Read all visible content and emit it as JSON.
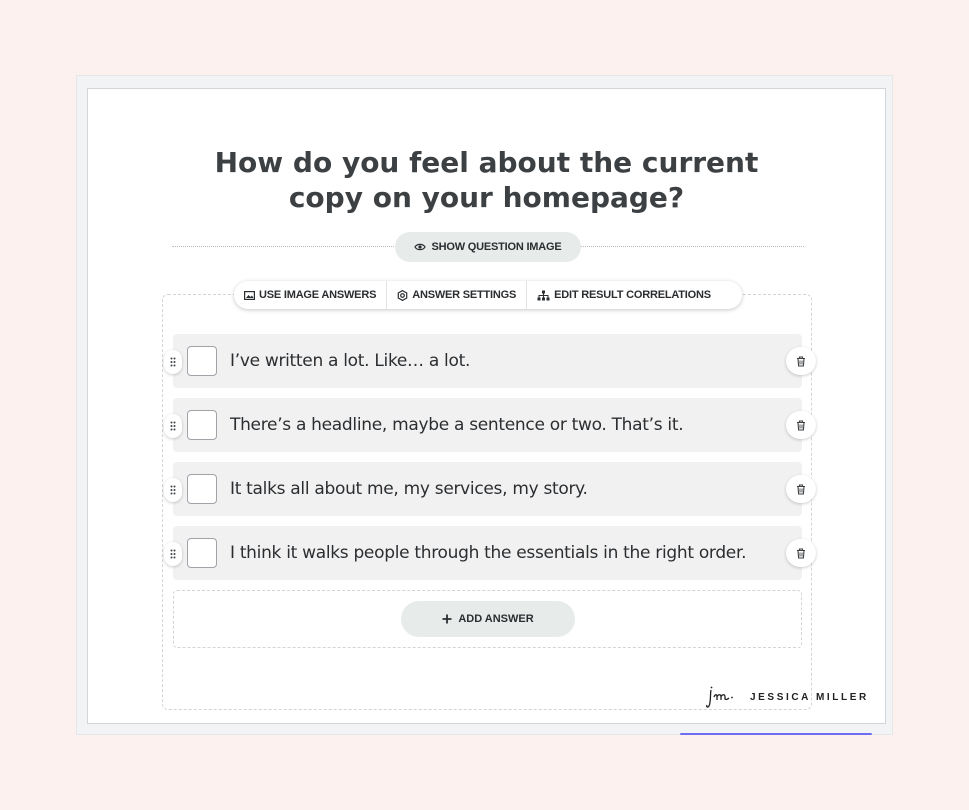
{
  "question": {
    "title": "How do you feel about the current copy on your homepage?",
    "show_image_label": "SHOW QUESTION IMAGE"
  },
  "toolbar": {
    "image_answers_label": "USE IMAGE ANSWERS",
    "answer_settings_label": "ANSWER SETTINGS",
    "edit_correlations_label": "EDIT RESULT CORRELATIONS"
  },
  "answers": [
    {
      "text": "I’ve written a lot. Like… a lot."
    },
    {
      "text": "There’s a headline, maybe a sentence or two. That’s it."
    },
    {
      "text": "It talks all about me, my services, my story."
    },
    {
      "text": "I think it walks people through the essentials in the right order."
    }
  ],
  "add_answer_label": "ADD ANSWER",
  "brand": {
    "monogram": "jm",
    "name": "JESSICA MILLER"
  },
  "icons": {
    "show_image": "eye-icon",
    "image_answers": "image-icon",
    "answer_settings": "gear-icon",
    "edit_correlations": "sitemap-icon",
    "drag": "drag-handle-icon",
    "delete": "trash-icon",
    "add": "plus-icon"
  },
  "colors": {
    "page_background": "#fcf1ee",
    "pill_background": "#e7ebea",
    "answer_background": "#f1f1f1",
    "accent_line": "#6b6ef0"
  }
}
